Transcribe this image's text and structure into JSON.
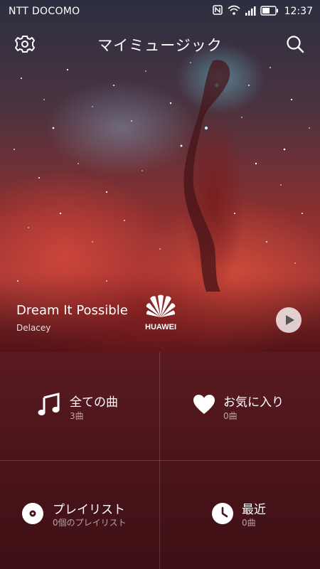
{
  "status_bar": {
    "carrier": "NTT DOCOMO",
    "time": "12:37"
  },
  "header": {
    "title": "マイミュージック"
  },
  "now_playing": {
    "title": "Dream It Possible",
    "artist": "Delacey",
    "brand": "HUAWEI"
  },
  "grid": [
    {
      "label": "全ての曲",
      "sub": "3曲",
      "icon": "music-note-icon"
    },
    {
      "label": "お気に入り",
      "sub": "0曲",
      "icon": "heart-icon"
    },
    {
      "label": "プレイリスト",
      "sub": "0個のプレイリスト",
      "icon": "disc-icon"
    },
    {
      "label": "最近",
      "sub": "0曲",
      "icon": "clock-icon"
    }
  ],
  "colors": {
    "panel": "#4a141a",
    "accent": "#ffffff"
  }
}
